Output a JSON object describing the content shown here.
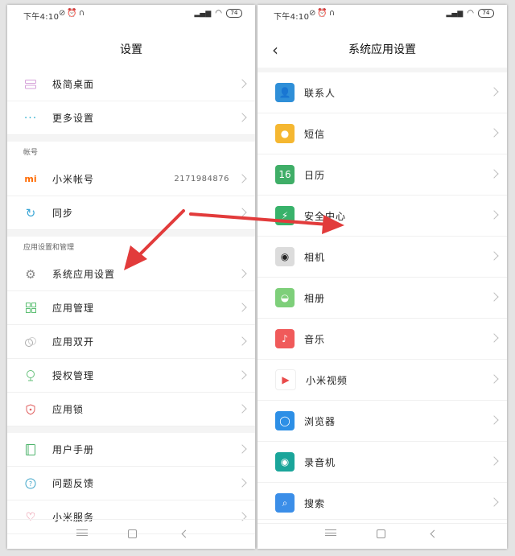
{
  "status": {
    "time": "下午4:10",
    "battery": "74"
  },
  "left": {
    "title": "设置",
    "group1": [
      {
        "label": "极简桌面",
        "icon": "minimal-desktop-icon"
      },
      {
        "label": "更多设置",
        "icon": "more-settings-icon"
      }
    ],
    "account_section": "帐号",
    "account_rows": [
      {
        "label": "小米帐号",
        "value": "2171984876",
        "icon": "mi-account-icon"
      },
      {
        "label": "同步",
        "icon": "sync-icon"
      }
    ],
    "apps_section": "应用设置和管理",
    "apps_rows": [
      {
        "label": "系统应用设置",
        "icon": "gear-icon"
      },
      {
        "label": "应用管理",
        "icon": "app-grid-icon"
      },
      {
        "label": "应用双开",
        "icon": "dual-apps-icon"
      },
      {
        "label": "授权管理",
        "icon": "permission-icon"
      },
      {
        "label": "应用锁",
        "icon": "app-lock-icon"
      }
    ],
    "help_rows": [
      {
        "label": "用户手册",
        "icon": "manual-icon"
      },
      {
        "label": "问题反馈",
        "icon": "feedback-icon"
      },
      {
        "label": "小米服务",
        "icon": "heart-icon"
      }
    ]
  },
  "right": {
    "title": "系统应用设置",
    "apps": [
      {
        "label": "联系人",
        "icon": "contacts-icon",
        "color": "#2f8fd8",
        "glyph": "👤"
      },
      {
        "label": "短信",
        "icon": "sms-icon",
        "color": "#f5b731",
        "glyph": "●"
      },
      {
        "label": "日历",
        "icon": "calendar-icon",
        "color": "#3fae67",
        "glyph": "16"
      },
      {
        "label": "安全中心",
        "icon": "security-icon",
        "color": "#38b26a",
        "glyph": "⚡"
      },
      {
        "label": "相机",
        "icon": "camera-icon",
        "color": "#dcdcdc",
        "glyph": "◉"
      },
      {
        "label": "相册",
        "icon": "gallery-icon",
        "color": "#7ecf7a",
        "glyph": "◒"
      },
      {
        "label": "音乐",
        "icon": "music-icon",
        "color": "#f05a5a",
        "glyph": "♪"
      },
      {
        "label": "小米视频",
        "icon": "video-icon",
        "color": "#ffffff",
        "glyph": "▶"
      },
      {
        "label": "浏览器",
        "icon": "browser-icon",
        "color": "#2d8fe6",
        "glyph": "◯"
      },
      {
        "label": "录音机",
        "icon": "recorder-icon",
        "color": "#1aa59a",
        "glyph": "◉"
      },
      {
        "label": "搜索",
        "icon": "search-icon",
        "color": "#3b8ee8",
        "glyph": "⌕"
      }
    ]
  },
  "colors": {
    "annotation_arrow": "#e23b3b",
    "mi_orange": "#ff6a00"
  }
}
